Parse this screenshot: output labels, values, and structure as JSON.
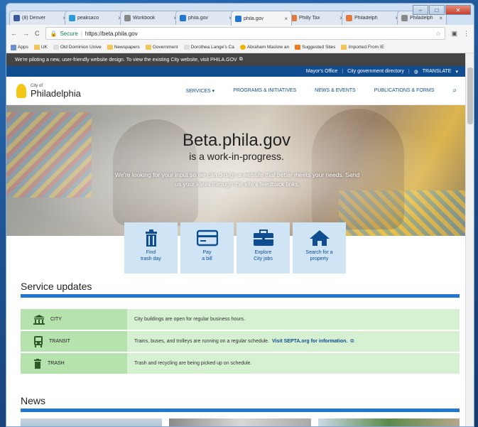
{
  "browser": {
    "tabs": [
      {
        "title": "(8) Denver",
        "color": "#3b5998",
        "active": false
      },
      {
        "title": "peaksaco",
        "color": "#2a9bd6",
        "active": false
      },
      {
        "title": "Workbook",
        "color": "#888888",
        "active": false
      },
      {
        "title": "phila.gov",
        "color": "#2176d2",
        "active": false
      },
      {
        "title": "phila.gov",
        "color": "#2176d2",
        "active": true
      },
      {
        "title": "Philly Tax",
        "color": "#e07a3e",
        "active": false
      },
      {
        "title": "Philadelph",
        "color": "#e07a3e",
        "active": false
      },
      {
        "title": "Philadelph",
        "color": "#888888",
        "active": false
      }
    ],
    "secure_label": "Secure",
    "url": "https://beta.phila.gov",
    "bookmarks": [
      "Apps",
      "UK",
      "Old Dominion Unive",
      "Newspapers",
      "Government",
      "Dorothea Lange's Ca",
      "Abraham Maslow an",
      "Suggested Sites",
      "Imported From IE"
    ]
  },
  "site": {
    "pilot_banner": "We're piloting a new, user-friendly website design. To view the existing City website, visit PHILA.GOV",
    "utility": {
      "mayor": "Mayor's Office",
      "directory": "City government directory",
      "translate": "TRANSLATE"
    },
    "logo": {
      "small": "City of",
      "name": "Philadelphia"
    },
    "nav": [
      "SERVICES",
      "PROGRAMS & INITIATIVES",
      "NEWS & EVENTS",
      "PUBLICATIONS & FORMS"
    ],
    "hero": {
      "title": "Beta.phila.gov",
      "subtitle": "is a work-in-progress.",
      "body": "We're looking for your input so we can design a website that better meets your needs. Send us your ideas through the site's feedback links."
    },
    "tiles": [
      {
        "line1": "Find",
        "line2": "trash day",
        "icon": "trash-icon"
      },
      {
        "line1": "Pay",
        "line2": "a bill",
        "icon": "credit-card-icon"
      },
      {
        "line1": "Explore",
        "line2": "City jobs",
        "icon": "briefcase-icon"
      },
      {
        "line1": "Search for a",
        "line2": "property",
        "icon": "home-icon"
      }
    ],
    "service_updates_title": "Service updates",
    "updates": [
      {
        "label": "CITY",
        "icon": "building-icon",
        "message": "City buildings are open for regular business hours.",
        "link": ""
      },
      {
        "label": "TRANSIT",
        "icon": "bus-icon",
        "message": "Trains, buses, and trolleys are running on a regular schedule.",
        "link": "Visit SEPTA.org for information."
      },
      {
        "label": "TRASH",
        "icon": "trash-icon",
        "message": "Trash and recycling are being picked up on schedule.",
        "link": ""
      }
    ],
    "news_title": "News"
  },
  "colors": {
    "accent": "#2176d2",
    "navy": "#0f4d90",
    "update_bg": "#d6f0d2",
    "update_label_bg": "#b5e2ad",
    "tile_bg": "#cfe5f5"
  }
}
